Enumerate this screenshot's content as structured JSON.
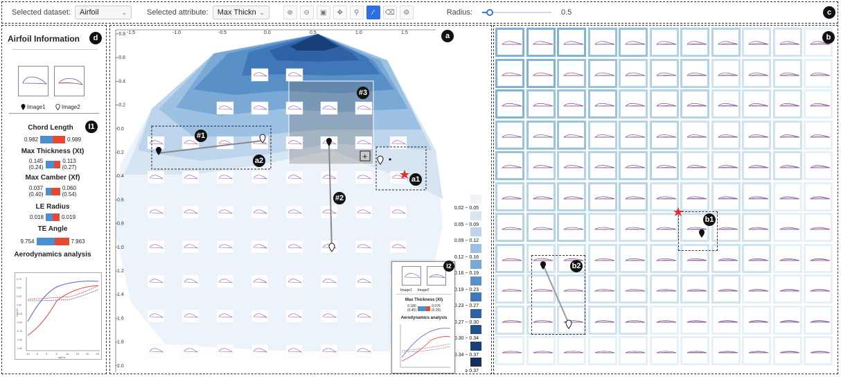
{
  "toolbar": {
    "dataset_label": "Selected dataset:",
    "dataset_value": "Airfoil",
    "attribute_label": "Selected attribute:",
    "attribute_value": "Max Thickn",
    "radius_label": "Radius:",
    "radius_value": "0.5",
    "radius_fraction": 0.1,
    "tools": [
      "zoom-in-icon",
      "zoom-out-icon",
      "fit-view-icon",
      "pan-icon",
      "pin-icon",
      "draw-line-icon",
      "eraser-icon",
      "settings-icon"
    ],
    "active_tool": "draw-line-icon"
  },
  "badges": {
    "a": "a",
    "b": "b",
    "c": "c",
    "d": "d",
    "i1": "I1",
    "i2": "I2",
    "a1": "a1",
    "a2": "a2",
    "b1": "b1",
    "b2": "b2",
    "p1": "#1",
    "p2": "#2",
    "p3": "#3"
  },
  "left_panel": {
    "title": "Airfoil Information",
    "image1_label": "Image1",
    "image2_label": "Image2",
    "metrics": [
      {
        "name": "Chord Length",
        "left": "0.982",
        "right": "0.989",
        "blue": 0.5
      },
      {
        "name": "Max Thickness (Xt)",
        "left": "0.145",
        "left2": "(0.24)",
        "right": "0.113",
        "right2": "(0.27)",
        "blue": 0.56
      },
      {
        "name": "Max Camber (Xf)",
        "left": "0.037",
        "left2": "(0.40)",
        "right": "0.060",
        "right2": "(0.54)",
        "blue": 0.38
      },
      {
        "name": "LE Radius",
        "left": "0.018",
        "right": "0.019",
        "blue": 0.49
      },
      {
        "name": "TE Angle",
        "left": "9.754",
        "right": "7.963",
        "blue": 0.55
      }
    ],
    "aero_title": "Aerodynamics analysis",
    "chart_ylabel": "CL/CD",
    "chart_xlabel": "alpha",
    "chart_xticks": [
      "-10",
      "-5",
      "0",
      "5",
      "10",
      "15",
      "20",
      "25"
    ],
    "chart_yticks": [
      "0.75",
      "0.50",
      "0.25",
      "0.00",
      "-0.25",
      "-0.50",
      "-0.75",
      "-1.00",
      "-1.25"
    ]
  },
  "map": {
    "x_ticks": [
      "-1.5",
      "-1.0",
      "-0.5",
      "0.0",
      "0.5",
      "1.0",
      "1.5"
    ],
    "y_ticks": [
      "-0.8",
      "-0.6",
      "-0.4",
      "-0.2",
      "0.0",
      "0.2",
      "0.4",
      "0.6",
      "0.8",
      "1.0",
      "1.2",
      "1.4",
      "1.6",
      "1.8",
      "2.0"
    ],
    "colors": [
      "#edf3fa",
      "#d7e5f3",
      "#bcd4ec",
      "#9cc1e3",
      "#7aa9d6",
      "#5a90c8",
      "#3f77b8",
      "#2e62a5",
      "#22508f",
      "#193f78",
      "#142f5c"
    ],
    "legend": [
      "0.02 ~ 0.05",
      "0.05 ~ 0.09",
      "0.09 ~ 0.12",
      "0.12 ~ 0.16",
      "0.16 ~ 0.19",
      "0.19 ~ 0.23",
      "0.23 ~ 0.27",
      "0.27 ~ 0.30",
      "0.30 ~ 0.34",
      "0.34 ~ 0.37",
      "≥ 0.37"
    ]
  },
  "popup": {
    "image1_label": "Image1",
    "image2_label": "Image2",
    "metric_title": "Max Thickness (Xt)",
    "left": "0.180",
    "left2": "(0.40)",
    "right": "0.076",
    "right2": "(0.20)",
    "aero_title": "Aerodynamics analysis"
  }
}
